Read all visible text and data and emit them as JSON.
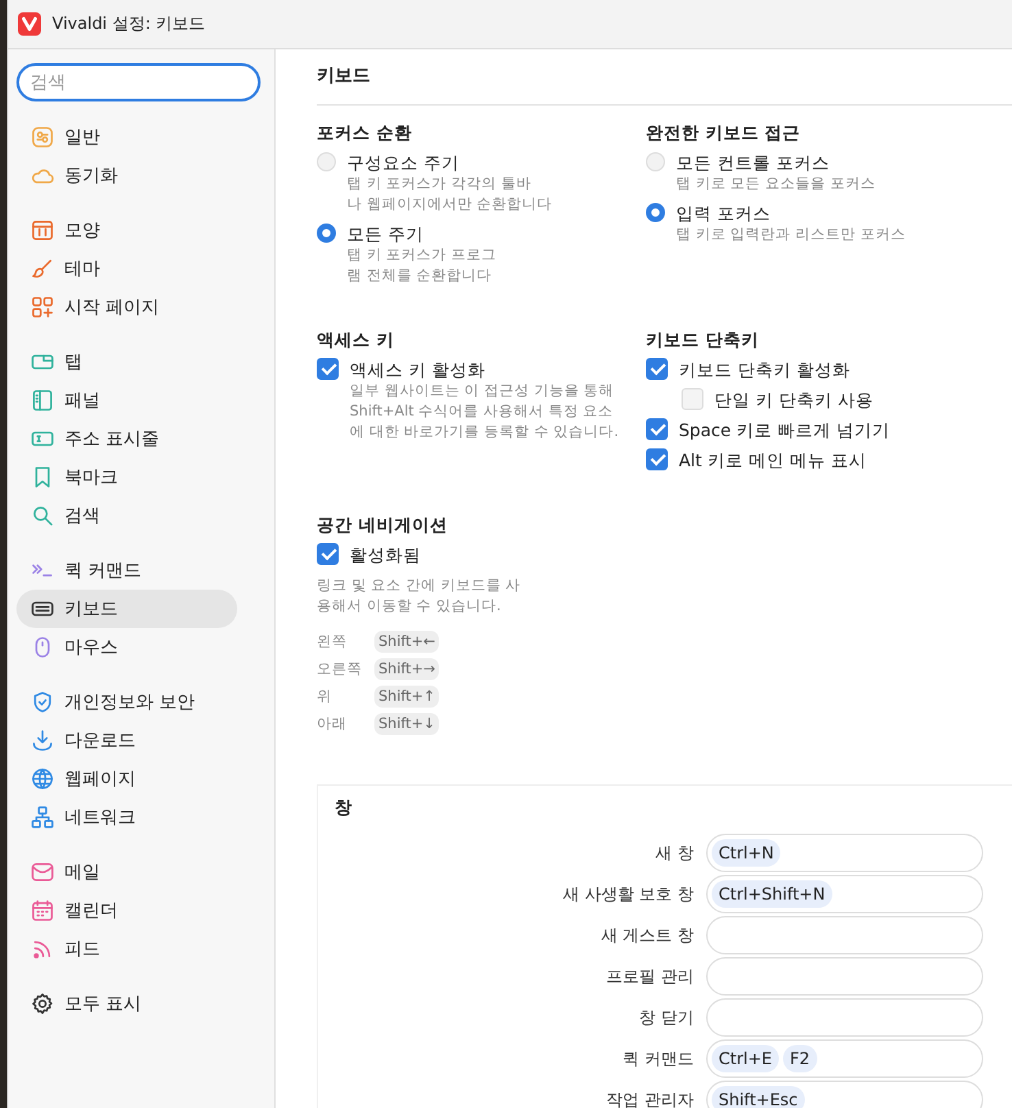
{
  "window": {
    "title": "Vivaldi 설정: 키보드"
  },
  "sidebar": {
    "search": {
      "placeholder": "검색"
    },
    "groups": [
      {
        "items": [
          {
            "label": "일반",
            "selected": false
          },
          {
            "label": "동기화",
            "selected": false
          }
        ]
      },
      {
        "items": [
          {
            "label": "모양",
            "selected": false
          },
          {
            "label": "테마",
            "selected": false
          },
          {
            "label": "시작 페이지",
            "selected": false
          }
        ]
      },
      {
        "items": [
          {
            "label": "탭",
            "selected": false
          },
          {
            "label": "패널",
            "selected": false
          },
          {
            "label": "주소 표시줄",
            "selected": false
          },
          {
            "label": "북마크",
            "selected": false
          },
          {
            "label": "검색",
            "selected": false
          }
        ]
      },
      {
        "items": [
          {
            "label": "퀵 커맨드",
            "selected": false
          },
          {
            "label": "키보드",
            "selected": true
          },
          {
            "label": "마우스",
            "selected": false
          }
        ]
      },
      {
        "items": [
          {
            "label": "개인정보와 보안",
            "selected": false
          },
          {
            "label": "다운로드",
            "selected": false
          },
          {
            "label": "웹페이지",
            "selected": false
          },
          {
            "label": "네트워크",
            "selected": false
          }
        ]
      },
      {
        "items": [
          {
            "label": "메일",
            "selected": false
          },
          {
            "label": "캘린더",
            "selected": false
          },
          {
            "label": "피드",
            "selected": false
          }
        ]
      },
      {
        "items": [
          {
            "label": "모두 표시",
            "selected": false
          }
        ]
      }
    ]
  },
  "page_title": "키보드",
  "sections": [
    {
      "title": "포커스 순환",
      "options": [
        {
          "kind": "radio",
          "label": "구성요소 주기",
          "description": "탭 키 포커스가 각각의 툴바\n나 웹페이지에서만 순환합니다",
          "selected": false
        },
        {
          "kind": "radio",
          "label": "모든 주기",
          "description": "탭 키 포커스가 프로그\n램 전체를 순환합니다",
          "selected": true
        }
      ]
    },
    {
      "title": "완전한 키보드 접근",
      "options": [
        {
          "kind": "radio",
          "label": "모든 컨트롤 포커스",
          "description": "탭 키로 모든 요소들을 포커스",
          "selected": false
        },
        {
          "kind": "radio",
          "label": "입력 포커스",
          "description": "탭 키로 입력란과 리스트만 포커스",
          "selected": true
        }
      ]
    },
    {
      "title": "액세스 키",
      "options": [
        {
          "kind": "checkbox",
          "label": "액세스 키 활성화",
          "description": "일부 웹사이트는 이 접근성 기능을 통해\nShift+Alt 수식어를 사용해서 특정 요소\n에 대한 바로가기를 등록할 수 있습니다.",
          "checked": true
        }
      ]
    },
    {
      "title": "키보드 단축키",
      "options": [
        {
          "kind": "checkbox",
          "label": "키보드 단축키 활성화",
          "checked": true,
          "children": [
            {
              "kind": "checkbox",
              "label": "단일 키 단축키 사용",
              "checked": false
            }
          ]
        },
        {
          "kind": "checkbox",
          "label": "Space 키로 빠르게 넘기기",
          "checked": true
        },
        {
          "kind": "checkbox",
          "label": "Alt 키로 메인 메뉴 표시",
          "checked": true
        }
      ]
    },
    {
      "title": "공간 네비게이션",
      "options": [
        {
          "kind": "checkbox",
          "label": "활성화됨",
          "checked": true
        }
      ],
      "description": "링크 및 요소 간에 키보드를 사\n용해서 이동할 수 있습니다.",
      "keys": [
        {
          "label": "왼쪽",
          "shortcut": "Shift+←"
        },
        {
          "label": "오른쪽",
          "shortcut": "Shift+→"
        },
        {
          "label": "위",
          "shortcut": "Shift+↑"
        },
        {
          "label": "아래",
          "shortcut": "Shift+↓"
        }
      ]
    }
  ],
  "shortcuts": {
    "title": "창",
    "rows": [
      {
        "label": "새 창",
        "keys": [
          "Ctrl+N"
        ]
      },
      {
        "label": "새 사생활 보호 창",
        "keys": [
          "Ctrl+Shift+N"
        ]
      },
      {
        "label": "새 게스트 창",
        "keys": []
      },
      {
        "label": "프로필 관리",
        "keys": []
      },
      {
        "label": "창 닫기",
        "keys": []
      },
      {
        "label": "퀵 커맨드",
        "keys": [
          "Ctrl+E",
          "F2"
        ]
      },
      {
        "label": "작업 관리자",
        "keys": [
          "Shift+Esc"
        ]
      }
    ]
  }
}
